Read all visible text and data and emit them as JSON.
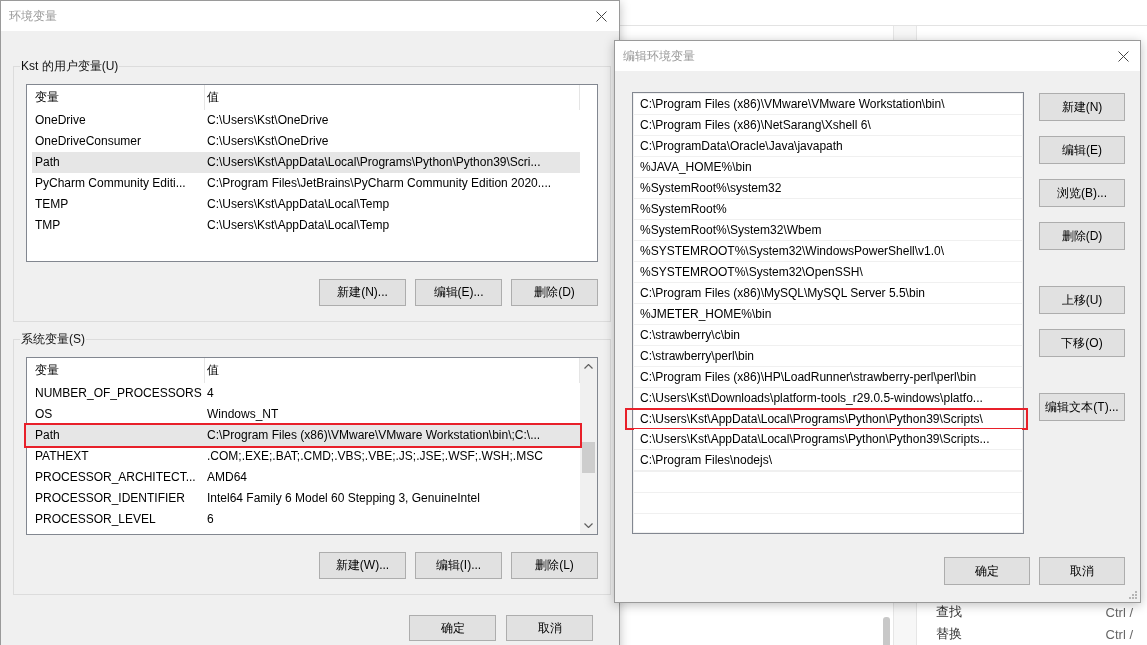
{
  "background_app": {
    "menu_items": [
      {
        "label": "查找",
        "shortcut": "Ctrl /"
      },
      {
        "label": "替换",
        "shortcut": "Ctrl /"
      }
    ]
  },
  "environment_dialog": {
    "title": "环境变量",
    "user_variables": {
      "title": "Kst 的用户变量(U)",
      "columns": [
        "变量",
        "值"
      ],
      "scrollable": false,
      "rows": [
        {
          "name": "OneDrive",
          "value": "C:\\Users\\Kst\\OneDrive",
          "selected": false,
          "annotated": false
        },
        {
          "name": "OneDriveConsumer",
          "value": "C:\\Users\\Kst\\OneDrive",
          "selected": false,
          "annotated": false
        },
        {
          "name": "Path",
          "value": "C:\\Users\\Kst\\AppData\\Local\\Programs\\Python\\Python39\\Scri...",
          "selected": true,
          "annotated": false
        },
        {
          "name": "PyCharm Community Editi...",
          "value": "C:\\Program Files\\JetBrains\\PyCharm Community Edition 2020....",
          "selected": false,
          "annotated": false
        },
        {
          "name": "TEMP",
          "value": "C:\\Users\\Kst\\AppData\\Local\\Temp",
          "selected": false,
          "annotated": false
        },
        {
          "name": "TMP",
          "value": "C:\\Users\\Kst\\AppData\\Local\\Temp",
          "selected": false,
          "annotated": false
        }
      ],
      "buttons": [
        "新建(N)...",
        "编辑(E)...",
        "删除(D)"
      ]
    },
    "system_variables": {
      "title": "系统变量(S)",
      "columns": [
        "变量",
        "值"
      ],
      "scrollable": true,
      "rows": [
        {
          "name": "NUMBER_OF_PROCESSORS",
          "value": "4",
          "selected": false,
          "annotated": false
        },
        {
          "name": "OS",
          "value": "Windows_NT",
          "selected": false,
          "annotated": false
        },
        {
          "name": "Path",
          "value": "C:\\Program Files (x86)\\VMware\\VMware Workstation\\bin\\;C:\\...",
          "selected": true,
          "annotated": true
        },
        {
          "name": "PATHEXT",
          "value": ".COM;.EXE;.BAT;.CMD;.VBS;.VBE;.JS;.JSE;.WSF;.WSH;.MSC",
          "selected": false,
          "annotated": false
        },
        {
          "name": "PROCESSOR_ARCHITECT...",
          "value": "AMD64",
          "selected": false,
          "annotated": false
        },
        {
          "name": "PROCESSOR_IDENTIFIER",
          "value": "Intel64 Family 6 Model 60 Stepping 3, GenuineIntel",
          "selected": false,
          "annotated": false
        },
        {
          "name": "PROCESSOR_LEVEL",
          "value": "6",
          "selected": false,
          "annotated": false
        }
      ],
      "buttons": [
        "新建(W)...",
        "编辑(I)...",
        "删除(L)"
      ]
    },
    "buttons": [
      "确定",
      "取消"
    ]
  },
  "edit_dialog": {
    "title": "编辑环境变量",
    "entries": [
      {
        "text": "C:\\Program Files (x86)\\VMware\\VMware Workstation\\bin\\",
        "annotated": false
      },
      {
        "text": "C:\\Program Files (x86)\\NetSarang\\Xshell 6\\",
        "annotated": false
      },
      {
        "text": "C:\\ProgramData\\Oracle\\Java\\javapath",
        "annotated": false
      },
      {
        "text": "%JAVA_HOME%\\bin",
        "annotated": false
      },
      {
        "text": "%SystemRoot%\\system32",
        "annotated": false
      },
      {
        "text": "%SystemRoot%",
        "annotated": false
      },
      {
        "text": "%SystemRoot%\\System32\\Wbem",
        "annotated": false
      },
      {
        "text": "%SYSTEMROOT%\\System32\\WindowsPowerShell\\v1.0\\",
        "annotated": false
      },
      {
        "text": "%SYSTEMROOT%\\System32\\OpenSSH\\",
        "annotated": false
      },
      {
        "text": "C:\\Program Files (x86)\\MySQL\\MySQL Server 5.5\\bin",
        "annotated": false
      },
      {
        "text": "%JMETER_HOME%\\bin",
        "annotated": false
      },
      {
        "text": "C:\\strawberry\\c\\bin",
        "annotated": false
      },
      {
        "text": "C:\\strawberry\\perl\\bin",
        "annotated": false
      },
      {
        "text": "C:\\Program Files (x86)\\HP\\LoadRunner\\strawberry-perl\\perl\\bin",
        "annotated": false
      },
      {
        "text": "C:\\Users\\Kst\\Downloads\\platform-tools_r29.0.5-windows\\platfo...",
        "annotated": false
      },
      {
        "text": "C:\\Users\\Kst\\AppData\\Local\\Programs\\Python\\Python39\\Scripts\\",
        "annotated": true
      },
      {
        "text": "C:\\Users\\Kst\\AppData\\Local\\Programs\\Python\\Python39\\Scripts...",
        "annotated": false
      },
      {
        "text": "C:\\Program Files\\nodejs\\",
        "annotated": false
      }
    ],
    "button_groups": [
      [
        "新建(N)",
        "编辑(E)",
        "浏览(B)...",
        "删除(D)"
      ],
      [
        "上移(U)",
        "下移(O)"
      ],
      [
        "编辑文本(T)..."
      ]
    ],
    "buttons": [
      "确定",
      "取消"
    ]
  }
}
